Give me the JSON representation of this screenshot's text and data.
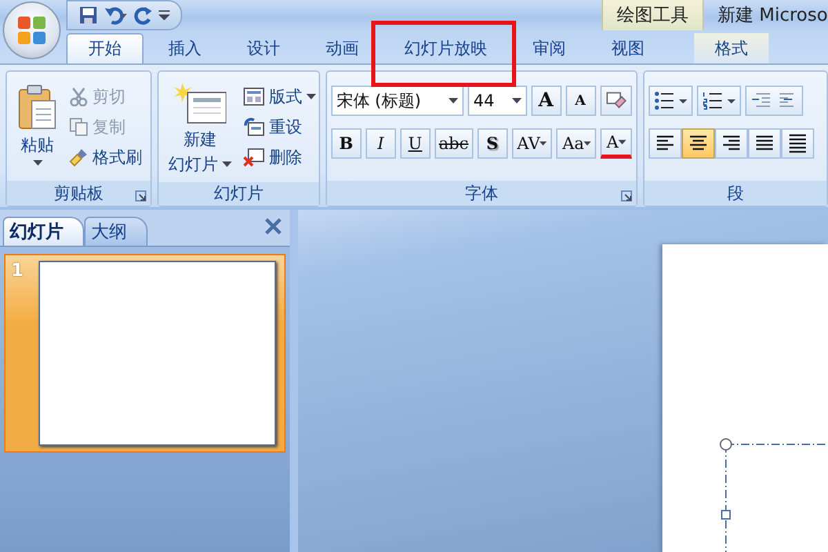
{
  "window": {
    "contextual_group": "绘图工具",
    "title_partial": "新建 Microso"
  },
  "ribbon_tabs": [
    {
      "label": "开始",
      "selected": true,
      "highlighted": false,
      "contextual": false
    },
    {
      "label": "插入",
      "selected": false,
      "highlighted": false,
      "contextual": false
    },
    {
      "label": "设计",
      "selected": false,
      "highlighted": false,
      "contextual": false
    },
    {
      "label": "动画",
      "selected": false,
      "highlighted": false,
      "contextual": false
    },
    {
      "label": "幻灯片放映",
      "selected": false,
      "highlighted": true,
      "contextual": false
    },
    {
      "label": "审阅",
      "selected": false,
      "highlighted": false,
      "contextual": false
    },
    {
      "label": "视图",
      "selected": false,
      "highlighted": false,
      "contextual": false
    },
    {
      "label": "格式",
      "selected": false,
      "highlighted": false,
      "contextual": true
    }
  ],
  "clipboard": {
    "label": "剪贴板",
    "paste": "粘贴",
    "commands": [
      {
        "label": "剪切",
        "kind": "cut",
        "disabled": true
      },
      {
        "label": "复制",
        "kind": "copy",
        "disabled": true
      },
      {
        "label": "格式刷",
        "kind": "brush",
        "disabled": false
      }
    ]
  },
  "slides_group": {
    "label": "幻灯片",
    "new_slide": [
      "新建",
      "幻灯片"
    ],
    "commands": [
      {
        "label": "版式",
        "kind": "layout",
        "dropdown": true
      },
      {
        "label": "重设",
        "kind": "reset",
        "dropdown": false
      },
      {
        "label": "删除",
        "kind": "delete",
        "dropdown": false
      }
    ]
  },
  "font": {
    "label": "字体",
    "font_name": "宋体 (标题)",
    "font_size": "44",
    "grow": "A",
    "shrink": "A",
    "format_buttons": [
      {
        "label": "B",
        "kind": "bold"
      },
      {
        "label": "I",
        "kind": "italic"
      },
      {
        "label": "U",
        "kind": "underline"
      },
      {
        "label": "abc",
        "kind": "strike"
      },
      {
        "label": "S",
        "kind": "shadow"
      },
      {
        "label": "AV",
        "kind": "spacing"
      },
      {
        "label": "Aa",
        "kind": "case"
      }
    ],
    "color_label": "A"
  },
  "paragraph": {
    "label_partial": "段",
    "align_buttons": [
      {
        "kind": "left",
        "selected": false
      },
      {
        "kind": "center",
        "selected": true
      },
      {
        "kind": "right",
        "selected": false
      },
      {
        "kind": "justify",
        "selected": false
      },
      {
        "kind": "distributed",
        "selected": false
      }
    ]
  },
  "slide_pane": {
    "tabs": [
      {
        "label": "幻灯片",
        "selected": true
      },
      {
        "label": "大纲",
        "selected": false
      }
    ],
    "thumbnails": [
      {
        "number": "1",
        "selected": true
      }
    ]
  }
}
